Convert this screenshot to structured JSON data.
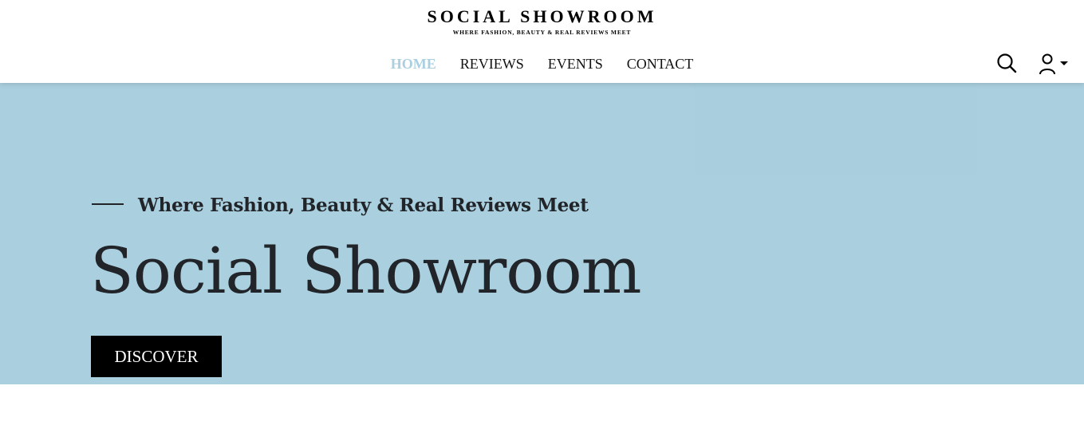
{
  "brand": {
    "title": "SOCIAL SHOWROOM",
    "tagline": "WHERE FASHION, BEAUTY & REAL REVIEWS MEET"
  },
  "nav": {
    "items": [
      {
        "label": "HOME",
        "active": true
      },
      {
        "label": "REVIEWS",
        "active": false
      },
      {
        "label": "EVENTS",
        "active": false
      },
      {
        "label": "CONTACT",
        "active": false
      }
    ]
  },
  "header_icons": {
    "search": "search-icon",
    "user": "user-icon",
    "dropdown": "caret-down-icon"
  },
  "hero": {
    "eyebrow": "Where Fashion, Beauty & Real Reviews Meet",
    "title": "Social Showroom",
    "cta_label": "DISCOVER"
  },
  "colors": {
    "hero_background": "#aacfdf",
    "nav_active": "#a9cfe0",
    "button_background": "#000000",
    "text_dark": "#212529"
  }
}
